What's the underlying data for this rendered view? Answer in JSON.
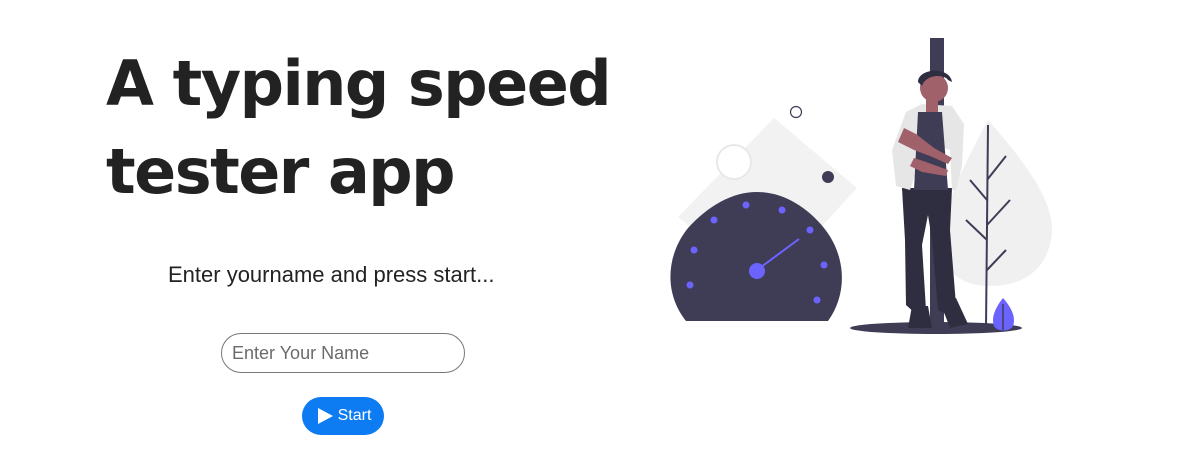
{
  "hero": {
    "title_line1": "A typing speed",
    "title_line2": "tester app"
  },
  "form": {
    "instruction": "Enter yourname and press start...",
    "name_placeholder": "Enter Your Name",
    "name_value": "",
    "start_label": "Start"
  },
  "colors": {
    "button": "#0d7cf2",
    "accent": "#6c63ff",
    "dark": "#3f3d56",
    "light_gray": "#f2f2f2"
  },
  "icons": {
    "start_button_icon": "play-icon",
    "illustration": "speedometer-person-illustration"
  }
}
